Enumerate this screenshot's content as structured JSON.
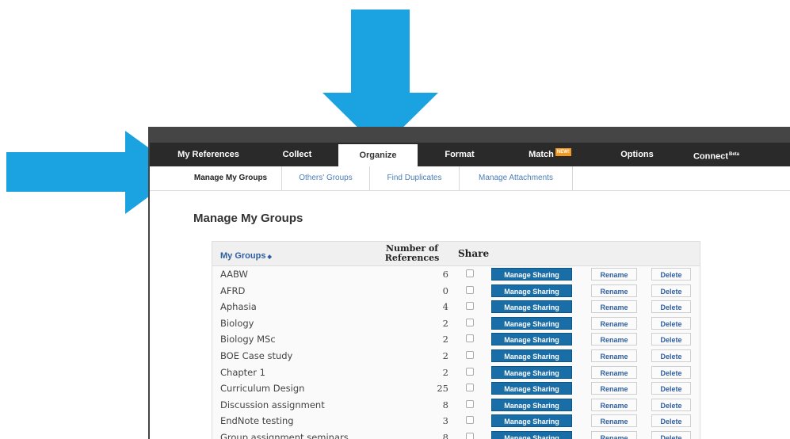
{
  "nav": {
    "tabs": [
      {
        "label": "My References"
      },
      {
        "label": "Collect"
      },
      {
        "label": "Organize"
      },
      {
        "label": "Format"
      },
      {
        "label": "Match",
        "badge": "NEW!"
      },
      {
        "label": "Options"
      },
      {
        "label": "Connect",
        "sup": "Beta"
      }
    ],
    "active": "Organize"
  },
  "subnav": {
    "tabs": [
      {
        "label": "Manage My Groups"
      },
      {
        "label": "Others' Groups"
      },
      {
        "label": "Find Duplicates"
      },
      {
        "label": "Manage Attachments"
      }
    ],
    "active": "Manage My Groups"
  },
  "page": {
    "title": "Manage My Groups"
  },
  "table": {
    "headers": {
      "groups": "My Groups",
      "sort_indicator": "◆",
      "count_line1": "Number of",
      "count_line2": "References",
      "share": "Share"
    },
    "button_labels": {
      "manage": "Manage Sharing",
      "rename": "Rename",
      "delete": "Delete"
    },
    "rows": [
      {
        "name": "AABW",
        "count": "6"
      },
      {
        "name": "AFRD",
        "count": "0"
      },
      {
        "name": "Aphasia",
        "count": "4"
      },
      {
        "name": "Biology",
        "count": "2"
      },
      {
        "name": "Biology MSc",
        "count": "2"
      },
      {
        "name": "BOE Case study",
        "count": "2"
      },
      {
        "name": "Chapter 1",
        "count": "2"
      },
      {
        "name": "Curriculum Design",
        "count": "25"
      },
      {
        "name": "Discussion assignment",
        "count": "8"
      },
      {
        "name": "EndNote testing",
        "count": "3"
      },
      {
        "name": "Group assignment seminars",
        "count": "8"
      }
    ]
  },
  "colors": {
    "arrow": "#1aa3e0",
    "navbar": "#2a2a2a",
    "manage_button": "#1a6ea8",
    "link": "#4a7db8",
    "new_badge": "#f39a1e"
  }
}
